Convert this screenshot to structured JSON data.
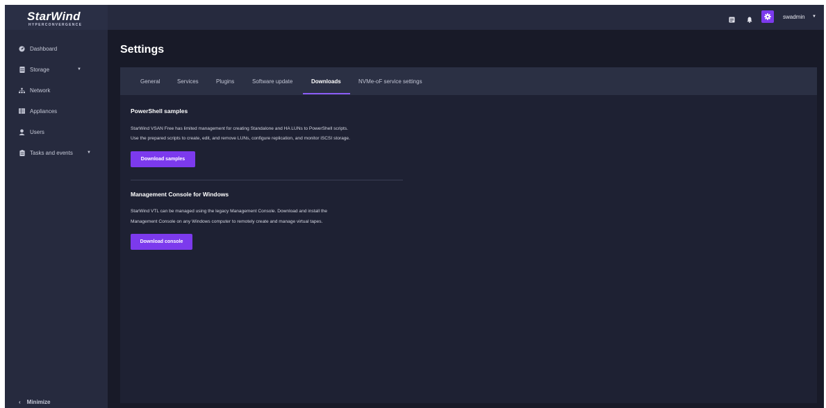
{
  "brand": {
    "name": "StarWind",
    "subtitle": "HYPERCONVERGENCE"
  },
  "sidebar": {
    "items": [
      {
        "label": "Dashboard",
        "icon": "dashboard-icon",
        "caret": false
      },
      {
        "label": "Storage",
        "icon": "storage-icon",
        "caret": true
      },
      {
        "label": "Network",
        "icon": "network-icon",
        "caret": false
      },
      {
        "label": "Appliances",
        "icon": "appliances-icon",
        "caret": false
      },
      {
        "label": "Users",
        "icon": "user-icon",
        "caret": false
      },
      {
        "label": "Tasks and events",
        "icon": "clipboard-icon",
        "caret": true
      }
    ],
    "minimize_label": "Minimize"
  },
  "topbar": {
    "username": "swadmin",
    "accent": "#7c3aed"
  },
  "page": {
    "title": "Settings"
  },
  "tabs": [
    {
      "label": "General",
      "active": false
    },
    {
      "label": "Services",
      "active": false
    },
    {
      "label": "Plugins",
      "active": false
    },
    {
      "label": "Software update",
      "active": false
    },
    {
      "label": "Downloads",
      "active": true
    },
    {
      "label": "NVMe-oF service settings",
      "active": false
    }
  ],
  "sections": {
    "powershell": {
      "title": "PowerShell samples",
      "line1": "StarWind VSAN Free has limited management for creating Standalone and HA LUNs to PowerShell scripts.",
      "line2": "Use the prepared scripts to create, edit, and remove LUNs, configure replication, and monitor iSCSI storage.",
      "button": "Download samples"
    },
    "console": {
      "title": "Management Console for Windows",
      "line1": "StarWind VTL can be managed using the legacy Management Console. Download and install the",
      "line2": "Management Console on any Windows computer to remotely create and manage virtual tapes.",
      "button": "Download console"
    }
  }
}
